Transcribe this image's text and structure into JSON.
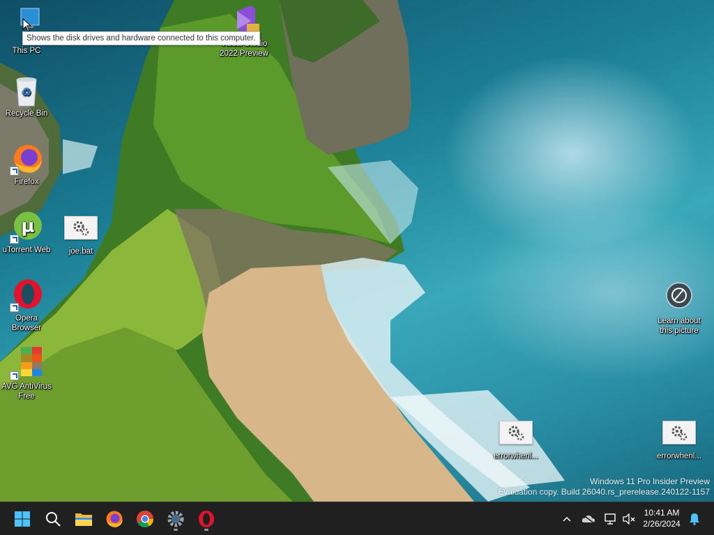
{
  "desktop": {
    "icons": [
      {
        "label": "This PC"
      },
      {
        "label": "Visual Studio 2022 Preview"
      },
      {
        "label": "Recycle Bin"
      },
      {
        "label": "Firefox"
      },
      {
        "label": "uTorrent Web"
      },
      {
        "label": "joe.bat"
      },
      {
        "label": "Opera Browser"
      },
      {
        "label": "AVG AntiVirus Free"
      },
      {
        "label": "Learn about this picture"
      },
      {
        "label": "errorwhenl..."
      },
      {
        "label": "errorwhenl..."
      }
    ],
    "tooltip": "Shows the disk drives and hardware connected to this computer.",
    "watermark": {
      "line1": "Windows 11 Pro Insider Preview",
      "line2": "Evaluation copy. Build 26040.rs_prerelease.240122-1157"
    }
  },
  "taskbar": {
    "pinned": [
      {
        "name": "start",
        "icon": "windows-logo-icon"
      },
      {
        "name": "search",
        "icon": "search-icon"
      },
      {
        "name": "file-explorer",
        "icon": "folder-icon"
      },
      {
        "name": "firefox",
        "icon": "firefox-icon"
      },
      {
        "name": "chrome",
        "icon": "chrome-icon"
      },
      {
        "name": "settings",
        "icon": "gear-icon"
      },
      {
        "name": "opera",
        "icon": "opera-icon"
      }
    ],
    "tray": {
      "time": "10:41 AM",
      "date": "2/26/2024"
    }
  },
  "colors": {
    "taskbar_bg": "#202020",
    "accent": "#0078d4",
    "opera_red": "#e3132d"
  }
}
